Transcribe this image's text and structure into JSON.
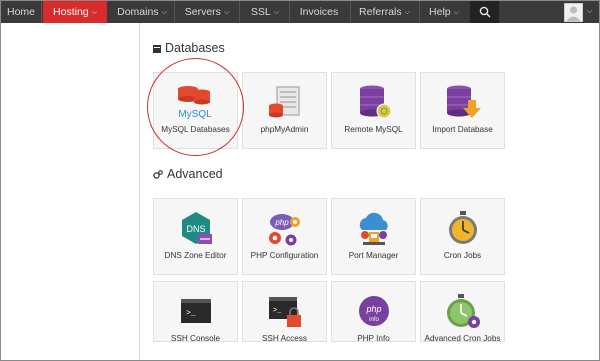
{
  "nav": {
    "items": [
      {
        "label": "Home",
        "dropdown": false
      },
      {
        "label": "Hosting",
        "dropdown": true,
        "active": true
      },
      {
        "label": "Domains",
        "dropdown": true
      },
      {
        "label": "Servers",
        "dropdown": true
      },
      {
        "label": "SSL",
        "dropdown": true
      },
      {
        "label": "Invoices",
        "dropdown": false
      },
      {
        "label": "Referrals",
        "dropdown": true
      },
      {
        "label": "Help",
        "dropdown": true
      }
    ],
    "chevron": "⌵",
    "search_icon": "search-icon",
    "avatar_icon": "user-avatar-icon"
  },
  "sections": {
    "databases": {
      "title": "Databases",
      "icon": "database-small-icon",
      "tiles": [
        {
          "label": "MySQL Databases",
          "icon": "mysql-icon",
          "icon_text": "MySQL"
        },
        {
          "label": "phpMyAdmin",
          "icon": "phpmyadmin-icon"
        },
        {
          "label": "Remote MySQL",
          "icon": "remote-mysql-icon"
        },
        {
          "label": "Import Database",
          "icon": "import-database-icon"
        }
      ]
    },
    "advanced": {
      "title": "Advanced",
      "icon": "cogs-small-icon",
      "tiles": [
        {
          "label": "DNS Zone Editor",
          "icon": "dns-zone-icon",
          "icon_text": "DNS"
        },
        {
          "label": "PHP Configuration",
          "icon": "php-config-icon",
          "icon_text": "php"
        },
        {
          "label": "Port Manager",
          "icon": "port-manager-icon"
        },
        {
          "label": "Cron Jobs",
          "icon": "cron-jobs-icon"
        },
        {
          "label": "SSH Console",
          "icon": "ssh-console-icon",
          "icon_text": ">_"
        },
        {
          "label": "SSH Access",
          "icon": "ssh-access-icon",
          "icon_text": ">_"
        },
        {
          "label": "PHP Info",
          "icon": "php-info-icon",
          "icon_text": "php",
          "icon_sub": "info"
        },
        {
          "label": "Advanced Cron Jobs",
          "icon": "advanced-cron-jobs-icon"
        }
      ]
    }
  },
  "colors": {
    "nav_bg": "#3a3a3a",
    "nav_active": "#d82b2b",
    "highlight": "#c9302c",
    "db_red": "#e2492f",
    "db_purple": "#7b3f9e"
  }
}
